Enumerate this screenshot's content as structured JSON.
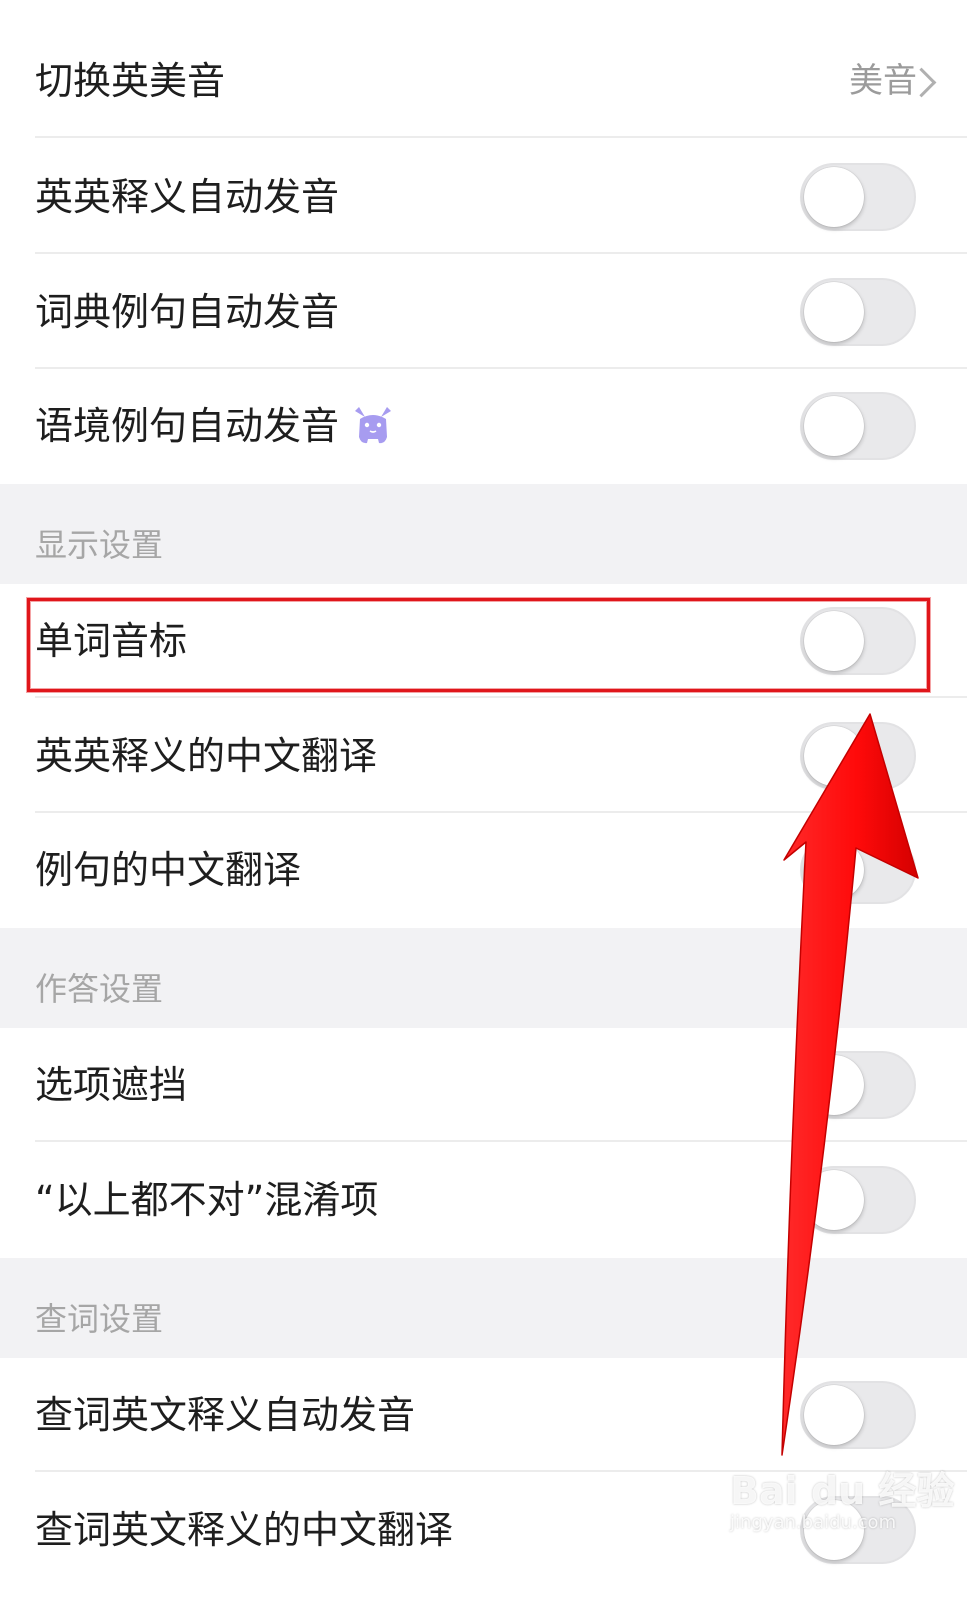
{
  "rows": {
    "accent": {
      "label": "切换英美音",
      "value": "美音"
    },
    "en_def_audio": {
      "label": "英英释义自动发音",
      "checked": false
    },
    "dict_example_audio": {
      "label": "词典例句自动发音",
      "checked": false
    },
    "context_example_audio": {
      "label": "语境例句自动发音",
      "checked": false
    },
    "phonetic": {
      "label": "单词音标",
      "checked": false
    },
    "en_def_translation": {
      "label": "英英释义的中文翻译",
      "checked": false
    },
    "example_translation": {
      "label": "例句的中文翻译",
      "checked": false
    },
    "option_cover": {
      "label": "选项遮挡",
      "checked": false
    },
    "none_distractor": {
      "label": "“以上都不对”混淆项",
      "checked": false
    },
    "lookup_def_audio": {
      "label": "查词英文释义自动发音",
      "checked": false
    },
    "lookup_def_translation": {
      "label": "查词英文释义的中文翻译",
      "checked": false
    }
  },
  "sections": {
    "display": "显示设置",
    "answer": "作答设置",
    "lookup": "查词设置"
  },
  "icons": {
    "vip": "vip-mascot-icon",
    "chevron": "chevron-right-icon"
  },
  "colors": {
    "highlight": "#e0161b",
    "arrow": "#ff0a0a",
    "vip_icon": "#a79cf0"
  },
  "watermark": {
    "main": "Bai du 经验",
    "sub": "jingyan.baidu.com"
  }
}
